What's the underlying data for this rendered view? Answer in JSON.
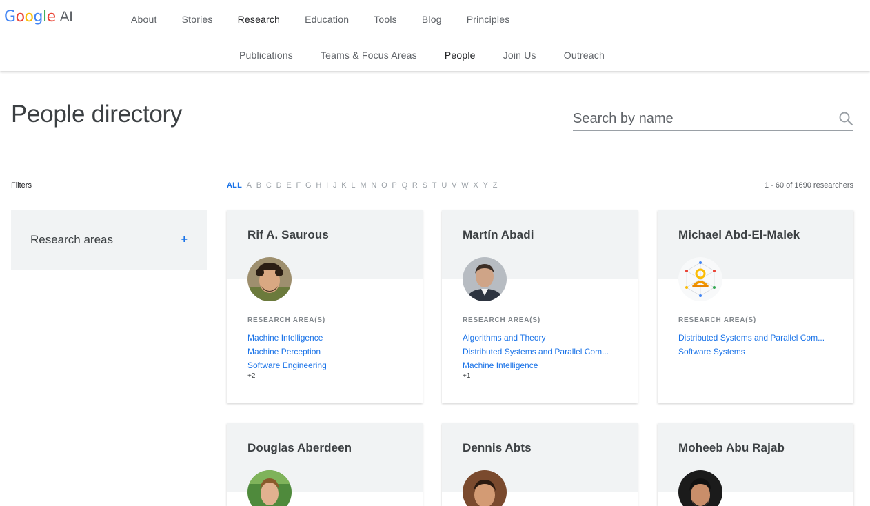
{
  "logo": {
    "google": "Google",
    "ai": "AI"
  },
  "nav": [
    "About",
    "Stories",
    "Research",
    "Education",
    "Tools",
    "Blog",
    "Principles"
  ],
  "nav_active": "Research",
  "subnav": [
    "Publications",
    "Teams & Focus Areas",
    "People",
    "Join Us",
    "Outreach"
  ],
  "subnav_active": "People",
  "page_title": "People directory",
  "search": {
    "placeholder": "Search by name"
  },
  "filters_label": "Filters",
  "alphabet": [
    "ALL",
    "A",
    "B",
    "C",
    "D",
    "E",
    "F",
    "G",
    "H",
    "I",
    "J",
    "K",
    "L",
    "M",
    "N",
    "O",
    "P",
    "Q",
    "R",
    "S",
    "T",
    "U",
    "V",
    "W",
    "X",
    "Y",
    "Z"
  ],
  "result_count": "1 - 60 of 1690 researchers",
  "filter_box": {
    "label": "Research areas",
    "toggle": "+"
  },
  "research_area_label": "RESEARCH AREA(S)",
  "people": [
    {
      "name": "Rif A. Saurous",
      "areas": [
        "Machine Intelligence",
        "Machine Perception",
        "Software Engineering"
      ],
      "more": "+2"
    },
    {
      "name": "Martín Abadi",
      "areas": [
        "Algorithms and Theory",
        "Distributed Systems and Parallel Com...",
        "Machine Intelligence"
      ],
      "more": "+1"
    },
    {
      "name": "Michael Abd-El-Malek",
      "areas": [
        "Distributed Systems and Parallel Com...",
        "Software Systems"
      ],
      "more": ""
    },
    {
      "name": "Douglas Aberdeen",
      "areas": [],
      "more": ""
    },
    {
      "name": "Dennis Abts",
      "areas": [],
      "more": ""
    },
    {
      "name": "Moheeb Abu Rajab",
      "areas": [],
      "more": ""
    }
  ],
  "colors": {
    "accent": "#1a73e8",
    "card_head": "#f1f3f4"
  }
}
